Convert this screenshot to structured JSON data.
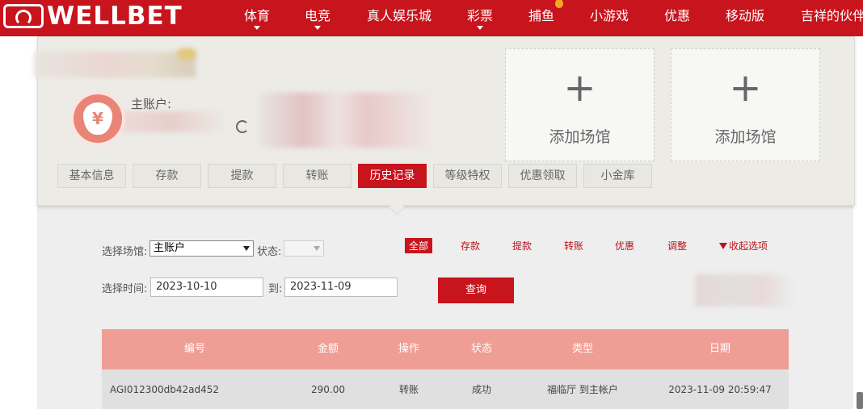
{
  "brand": {
    "logo_text": "WELLBET",
    "accent": "#c8141c"
  },
  "nav": [
    {
      "label": "体育",
      "caret": true
    },
    {
      "label": "电竞",
      "caret": true
    },
    {
      "label": "真人娱乐城",
      "caret": false
    },
    {
      "label": "彩票",
      "caret": true
    },
    {
      "label": "捕鱼",
      "caret": false,
      "badge": "flame-icon"
    },
    {
      "label": "小游戏",
      "caret": false
    },
    {
      "label": "优惠",
      "caret": false
    },
    {
      "label": "移动版",
      "caret": false
    },
    {
      "label": "吉祥的伙伴",
      "caret": false
    }
  ],
  "account": {
    "main_label": "主账户:",
    "icon": "money-bag-icon",
    "currency_symbol": "¥"
  },
  "venue_cards": [
    {
      "plus": "+",
      "label": "添加场馆"
    },
    {
      "plus": "+",
      "label": "添加场馆"
    }
  ],
  "tabs": [
    {
      "label": "基本信息",
      "active": false
    },
    {
      "label": "存款",
      "active": false
    },
    {
      "label": "提款",
      "active": false
    },
    {
      "label": "转账",
      "active": false
    },
    {
      "label": "历史记录",
      "active": true
    },
    {
      "label": "等级特权",
      "active": false
    },
    {
      "label": "优惠领取",
      "active": false
    },
    {
      "label": "小金库",
      "active": false
    }
  ],
  "filters": {
    "venue_label": "选择场馆:",
    "venue_value": "主账户",
    "status_label": "状态:",
    "status_value": "",
    "time_label": "选择时间:",
    "date_from": "2023-10-10",
    "to_label": "到:",
    "date_to": "2023-11-09",
    "query_label": "查询",
    "types": [
      {
        "label": "全部",
        "active": true
      },
      {
        "label": "存款",
        "active": false
      },
      {
        "label": "提款",
        "active": false
      },
      {
        "label": "转账",
        "active": false
      },
      {
        "label": "优惠",
        "active": false
      },
      {
        "label": "调整",
        "active": false
      }
    ],
    "collapse_label": "收起选项"
  },
  "table": {
    "headers": [
      "编号",
      "金额",
      "操作",
      "状态",
      "类型",
      "日期"
    ],
    "rows": [
      [
        "AGI012300db42ad452",
        "290.00",
        "转账",
        "成功",
        "福临厅 到主帐户",
        "2023-11-09 20:59:47"
      ]
    ]
  }
}
